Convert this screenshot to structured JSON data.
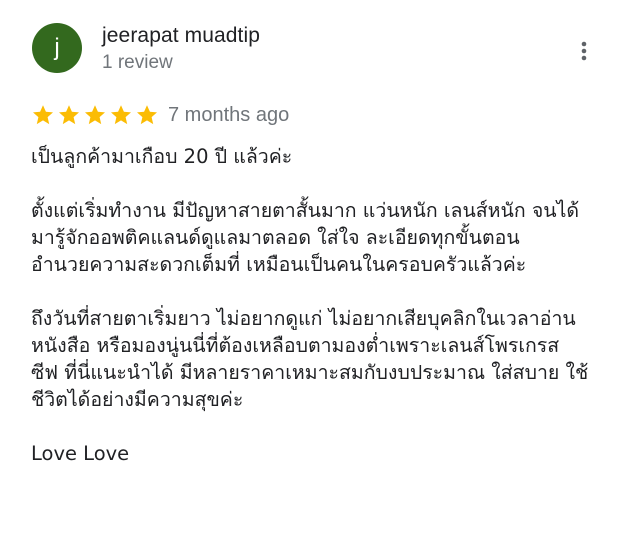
{
  "reviewer": {
    "initial": "j",
    "name": "jeerapat muadtip",
    "review_count": "1 review",
    "avatar_color": "#33691e"
  },
  "rating": {
    "stars": 5,
    "max_stars": 5,
    "star_color": "#fbbc04"
  },
  "date": "7 months ago",
  "menu_icon": "more-vert-icon",
  "review": {
    "paragraphs": [
      [
        "เป็นลูกค้ามาเกือบ 20 ปี แล้วค่ะ"
      ],
      [
        "ตั้งแต่เริ่มทำงาน มีปัญหาสายตาสั้นมาก แว่นหนัก เลนส์หนัก จนได้",
        "มารู้จักออพติคแลนด์ดูแลมาตลอด ใส่ใจ ละเอียดทุกขั้นตอน",
        "อำนวยความสะดวกเต็มที่ เหมือนเป็นคนในครอบครัวแล้วค่ะ"
      ],
      [
        "ถึงวันที่สายตาเริ่มยาว ไม่อยากดูแก่ ไม่อยากเสียบุคลิกในเวลาอ่าน",
        "หนังสือ หรือมองนู่นนี่ที่ต้องเหลือบตามองต่ำเพราะเลนส์โพรเกรส",
        "ซีฟ ที่นี่แนะนำได้ มีหลายราคาเหมาะสมกับงบประมาณ ใส่สบาย ใช้",
        "ชีวิตได้อย่างมีความสุขค่ะ"
      ],
      [
        "Love Love"
      ]
    ]
  }
}
